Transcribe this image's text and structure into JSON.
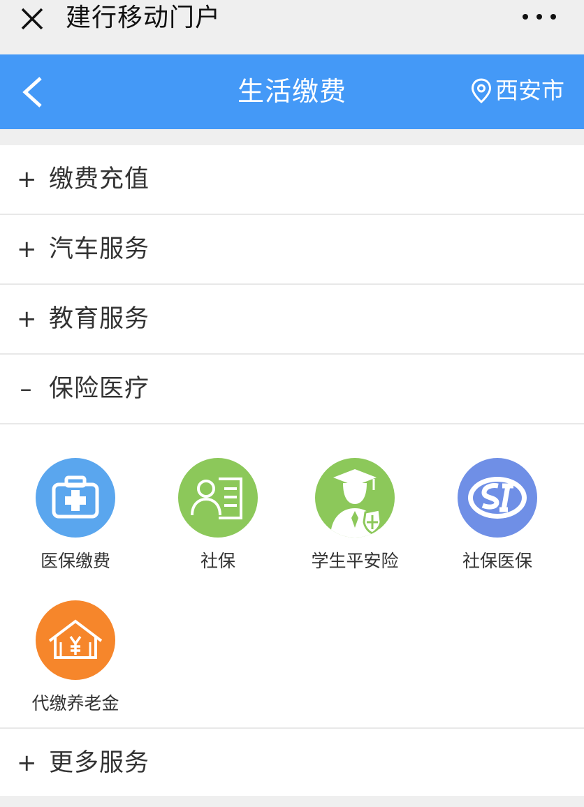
{
  "wechat_bar": {
    "close_icon": "close-icon",
    "title": "建行移动门户",
    "more_icon": "more-dots-icon"
  },
  "nav": {
    "back_icon": "chevron-left-icon",
    "title": "生活缴费",
    "location_icon": "location-pin-icon",
    "city": "西安市",
    "background_color": "#4499f7"
  },
  "sections": [
    {
      "toggle": "+",
      "label": "缴费充值",
      "expanded": false
    },
    {
      "toggle": "+",
      "label": "汽车服务",
      "expanded": false
    },
    {
      "toggle": "+",
      "label": "教育服务",
      "expanded": false
    },
    {
      "toggle": "–",
      "label": "保险医疗",
      "expanded": true
    }
  ],
  "insurance_items": [
    {
      "label": "医保缴费",
      "icon": "medical-kit-icon",
      "color": "#5aa6ee"
    },
    {
      "label": "社保",
      "icon": "id-card-icon",
      "color": "#8cc85a"
    },
    {
      "label": "学生平安险",
      "icon": "graduate-shield-icon",
      "color": "#8cc85a"
    },
    {
      "label": "社保医保",
      "icon": "si-logo-icon",
      "color": "#6f8fe6"
    },
    {
      "label": "代缴养老金",
      "icon": "house-yuan-icon",
      "color": "#f6862b"
    }
  ],
  "more_section": {
    "toggle": "+",
    "label": "更多服务",
    "expanded": false
  }
}
